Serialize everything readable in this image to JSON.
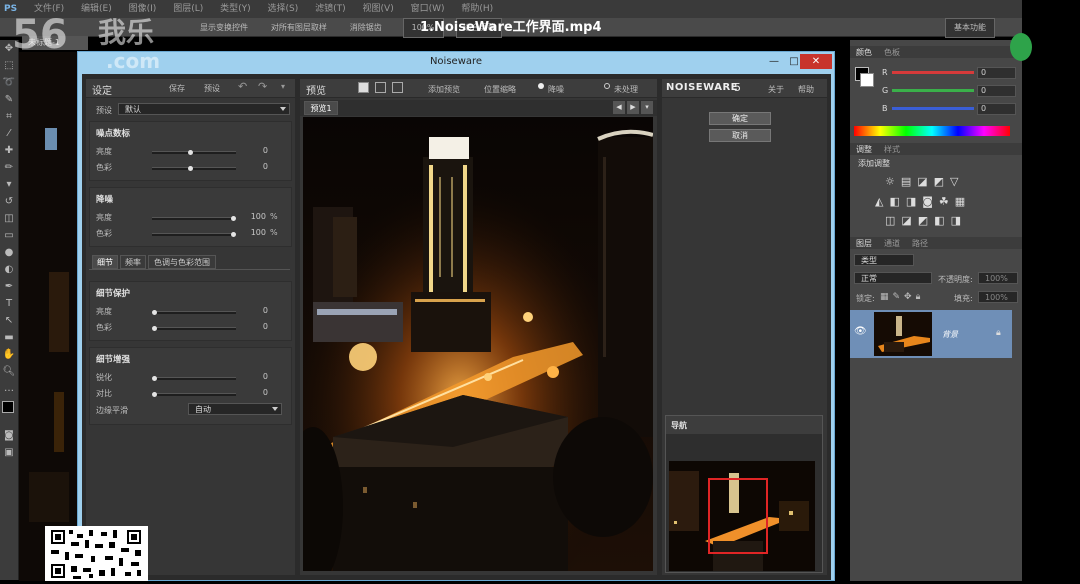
{
  "video": {
    "title": "1.NoiseWare工作界面.mp4"
  },
  "watermark": {
    "logo_number": "56",
    "logo_chars": "我乐",
    "domain": ".com"
  },
  "ps": {
    "menu": [
      "PS",
      "文件(F)",
      "编辑(E)",
      "图像(I)",
      "图层(L)",
      "类型(Y)",
      "选择(S)",
      "滤镜(T)",
      "视图(V)",
      "窗口(W)",
      "帮助(H)"
    ],
    "options": {
      "show_edges": "显示变换控件",
      "sample_all_layers": "对所有图层取样",
      "anti_alias": "消除锯齿",
      "zoom": "100%",
      "fit": "适合屏幕",
      "workspace": "基本功能"
    },
    "doc_tab": "未标题-1",
    "color_panel": {
      "tabs": [
        "颜色",
        "色板"
      ],
      "channels": [
        {
          "label": "R",
          "value": "0",
          "color": "#d63a3a"
        },
        {
          "label": "G",
          "value": "0",
          "color": "#3ab04a"
        },
        {
          "label": "B",
          "value": "0",
          "color": "#3a5ed6"
        }
      ]
    },
    "adjust_panel": {
      "tabs": [
        "调整",
        "样式"
      ],
      "title": "添加调整"
    },
    "layers_panel": {
      "tabs": [
        "图层",
        "通道",
        "路径"
      ],
      "kind": "类型",
      "blend": "正常",
      "opacity_label": "不透明度:",
      "opacity": "100%",
      "lock_label": "锁定:",
      "fill_label": "填充:",
      "fill": "100%",
      "layer_name": "背景"
    }
  },
  "nw": {
    "window_title": "Noiseware",
    "left": {
      "header": "设定",
      "save": "保存",
      "preset_btn": "预设",
      "preset_label": "预设",
      "preset_value": "默认",
      "sec_noise_level": "噪点数标",
      "nl_lum": "亮度",
      "nl_lum_val": "0",
      "nl_col": "色彩",
      "nl_col_val": "0",
      "sec_noise_reduce": "降噪",
      "nr_lum": "亮度",
      "nr_lum_val": "100",
      "nr_lum_unit": "%",
      "nr_col": "色彩",
      "nr_col_val": "100",
      "nr_col_unit": "%",
      "tabs": [
        "细节",
        "频率",
        "色调与色彩范围"
      ],
      "sec_detail_protect": "细节保护",
      "dp_lum": "亮度",
      "dp_lum_val": "0",
      "dp_col": "色彩",
      "dp_col_val": "0",
      "sec_detail_enhance": "细节增强",
      "de_sharp": "锐化",
      "de_sharp_val": "0",
      "de_contrast": "对比",
      "de_contrast_val": "0",
      "edge_label": "边缘平滑",
      "edge_value": "自动"
    },
    "center": {
      "header": "预览",
      "add_preview": "添加预览",
      "switch_area": "位置缩略",
      "before": "未处理",
      "after": "降噪",
      "preview_tab": "预览1"
    },
    "right": {
      "brand": "NOISEWARE",
      "version": "5",
      "about": "关于",
      "help": "帮助",
      "ok": "确定",
      "cancel": "取消",
      "navigator": "导航"
    }
  },
  "levels": {
    "nl_lum": 0.45,
    "nl_col": 0.45,
    "nr_lum": 1.0,
    "nr_col": 1.0,
    "dp_lum": 0.0,
    "dp_col": 0.0,
    "de_sharp": 0.0,
    "de_contrast": 0.0
  }
}
